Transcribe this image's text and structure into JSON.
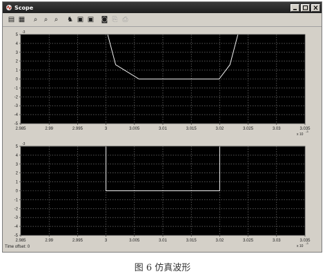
{
  "window": {
    "title": "Scope",
    "colors": {
      "titlebar": "#2a2a2a",
      "chrome": "#d4d0c8",
      "axes_bg": "#000000",
      "trace": "#f2f2f2",
      "grid": "#8a8a8a"
    }
  },
  "toolbar": {
    "items": [
      {
        "icon": "print-icon",
        "glyph": "▤"
      },
      {
        "icon": "parameters-icon",
        "glyph": "▦"
      },
      {
        "icon": "zoom-icon",
        "glyph": "⌕"
      },
      {
        "icon": "zoom-x-icon",
        "glyph": "⌕"
      },
      {
        "icon": "zoom-y-icon",
        "glyph": "⌕"
      },
      {
        "icon": "autoscale-icon",
        "glyph": "♞"
      },
      {
        "icon": "save-axes-icon",
        "glyph": "▣"
      },
      {
        "icon": "restore-axes-icon",
        "glyph": "▣"
      },
      {
        "icon": "floating-scope-icon",
        "glyph": "◙"
      },
      {
        "icon": "lock-axes-icon",
        "glyph": "⎘"
      },
      {
        "icon": "signal-selection-icon",
        "glyph": "⎙"
      }
    ]
  },
  "plots": [
    {
      "xticks": [
        "2.985",
        "2.99",
        "2.995",
        "3",
        "3.005",
        "3.01",
        "3.015",
        "3.02",
        "3.025",
        "3.03",
        "3.035"
      ],
      "yticks": [
        "5",
        "4",
        "3",
        "2",
        "1",
        "0",
        "-1",
        "-2",
        "-3",
        "-4",
        "-5"
      ],
      "x_exponent_label": "x 10",
      "x_exponent_sup": "-3",
      "exponent_top": "-3"
    },
    {
      "xticks": [
        "2.985",
        "2.99",
        "2.995",
        "3",
        "3.005",
        "3.01",
        "3.015",
        "3.02",
        "3.025",
        "3.03",
        "3.035"
      ],
      "yticks": [
        "5",
        "4",
        "3",
        "2",
        "1",
        "0",
        "-1",
        "-2",
        "-3",
        "-4",
        "-5"
      ],
      "x_exponent_label": "x 10",
      "x_exponent_sup": "-3",
      "exponent_top": "-3"
    }
  ],
  "chart_data": [
    {
      "type": "line",
      "xlim": [
        2.985,
        3.035
      ],
      "ylim": [
        -5,
        5
      ],
      "grid": true,
      "series": [
        {
          "x": [
            3.0003,
            3.0017,
            3.0058,
            3.0199,
            3.0218,
            3.0232
          ],
          "y": [
            5,
            1.6,
            0,
            0,
            1.6,
            5
          ]
        }
      ]
    },
    {
      "type": "line",
      "xlim": [
        2.985,
        3.035
      ],
      "ylim": [
        -5,
        5
      ],
      "grid": true,
      "series": [
        {
          "x": [
            2.985,
            3.0,
            3.0,
            3.02,
            3.02,
            3.035
          ],
          "y": [
            5,
            5,
            0,
            0,
            5,
            5
          ]
        }
      ]
    }
  ],
  "status": {
    "time_offset_label": "Time offset:",
    "time_offset_value": "0"
  },
  "caption": "图 6   仿真波形"
}
